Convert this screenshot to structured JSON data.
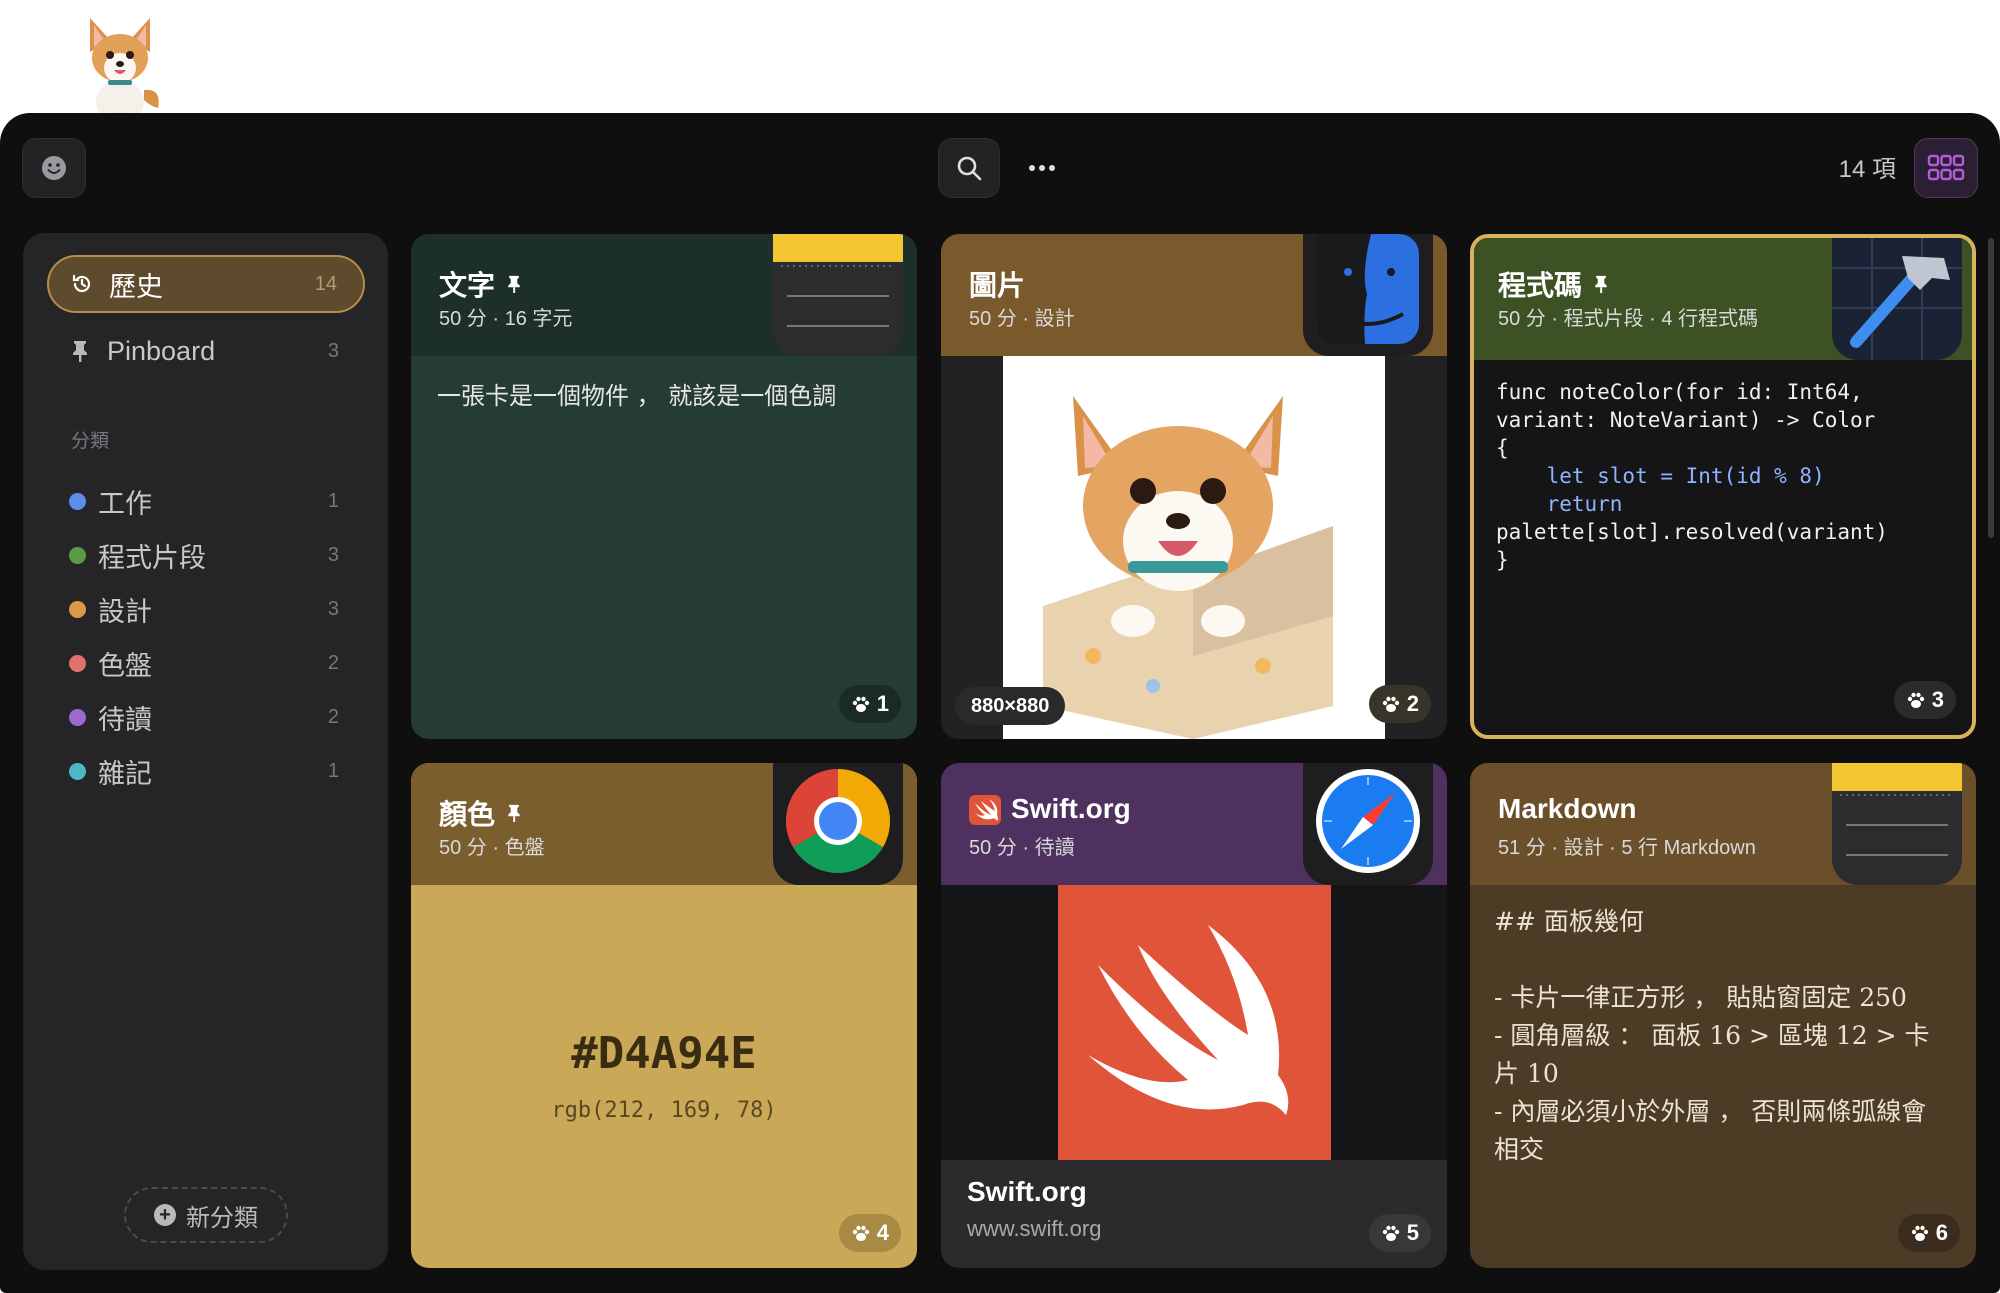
{
  "header": {
    "item_count": "14 項"
  },
  "sidebar": {
    "items": [
      {
        "label": "歷史",
        "count": "14",
        "icon": "history-icon",
        "active": true
      },
      {
        "label": "Pinboard",
        "count": "3",
        "icon": "pin-icon",
        "active": false
      }
    ],
    "category_heading": "分類",
    "categories": [
      {
        "label": "工作",
        "count": "1",
        "color": "#5b8def"
      },
      {
        "label": "程式片段",
        "count": "3",
        "color": "#5a9a45"
      },
      {
        "label": "設計",
        "count": "3",
        "color": "#d99a4a"
      },
      {
        "label": "色盤",
        "count": "2",
        "color": "#e2706d"
      },
      {
        "label": "待讀",
        "count": "2",
        "color": "#9b6ad0"
      },
      {
        "label": "雜記",
        "count": "1",
        "color": "#4fb6c4"
      }
    ],
    "new_category": "新分類"
  },
  "cards": {
    "text": {
      "title": "文字",
      "sub": "50 分 · 16 字元",
      "body": "一張卡是一個物件 ， 就該是一個色調",
      "badge": "1",
      "app_icon": "notes-icon"
    },
    "image": {
      "title": "圖片",
      "sub": "50 分 · 設計",
      "dims": "880×880",
      "badge": "2",
      "app_icon": "finder-icon"
    },
    "code": {
      "title": "程式碼",
      "sub": "50 分 · 程式片段 · 4 行程式碼",
      "badge": "3",
      "app_icon": "xcode-icon",
      "lines": [
        "func noteColor(for id: Int64,",
        "variant: NoteVariant) -> Color",
        "{",
        "    let slot = Int(id % 8)",
        "    return",
        "palette[slot].resolved(variant)",
        "}"
      ]
    },
    "color": {
      "title": "顏色",
      "sub": "50 分 · 色盤",
      "hex": "#D4A94E",
      "rgb": "rgb(212, 169, 78)",
      "badge": "4",
      "app_icon": "chrome-icon"
    },
    "link": {
      "title": "Swift.org",
      "sub": "50 分 · 待讀",
      "site_title": "Swift.org",
      "site_url": "www.swift.org",
      "badge": "5",
      "app_icon": "safari-icon"
    },
    "markdown": {
      "title": "Markdown",
      "sub": "51 分 · 設計 · 5 行 Markdown",
      "badge": "6",
      "app_icon": "notes-icon",
      "body": "## 面板幾何\n\n- 卡片一律正方形 ， 貼貼窗固定 250\n- 圓角層級 ： 面板 16 > 區塊 12 > 卡片 10\n- 內層必須小於外層 ， 否則兩條弧線會相交"
    }
  }
}
